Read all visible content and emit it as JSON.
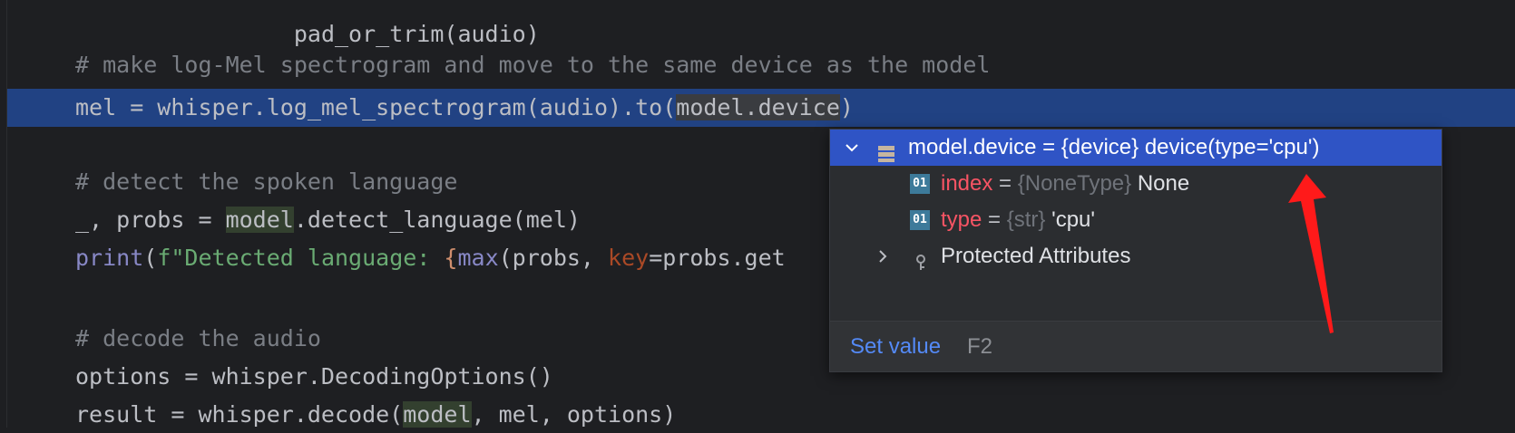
{
  "editor": {
    "line0": "    ",
    "comment1": "# make log-Mel spectrogram and move to the same device as the model",
    "mel_line": {
      "a": "mel = whisper.",
      "fn": "log_mel_spectrogram",
      "b": "(audio).to(",
      "sel": "model.device",
      "c": ")"
    },
    "comment2": "# detect the spoken language",
    "probs_line": {
      "a": "_, probs = ",
      "ref": "model",
      "b": ".detect_language(mel)"
    },
    "print_line": {
      "builtin": "print",
      "p1": "(",
      "fstr": "f\"Detected language: ",
      "brace": "{",
      "maxfn": "max",
      "p2": "(probs, ",
      "kw": "key",
      "p3": "=probs.get"
    },
    "comment3": "# decode the audio",
    "options_line": "options = whisper.DecodingOptions()",
    "result_line": {
      "a": "result = whisper.decode(",
      "ref": "model",
      "b": ", mel, options)"
    }
  },
  "debug_popup": {
    "root": {
      "text": "model.device = {device} device(type='cpu')"
    },
    "children": [
      {
        "icon": "01",
        "name": "index",
        "eq": " = ",
        "type": "{NoneType}",
        "value": " None"
      },
      {
        "icon": "01",
        "name": "type",
        "eq": " = ",
        "type": "{str}",
        "value": " 'cpu'"
      }
    ],
    "protected": "Protected Attributes",
    "footer": {
      "set_value": "Set value",
      "shortcut": "F2"
    }
  },
  "colors": {
    "editor_bg": "#1e1f22",
    "line_highlight": "#214283",
    "popup_selected": "#2f54c5",
    "annotation_arrow": "#ff1a1a"
  }
}
